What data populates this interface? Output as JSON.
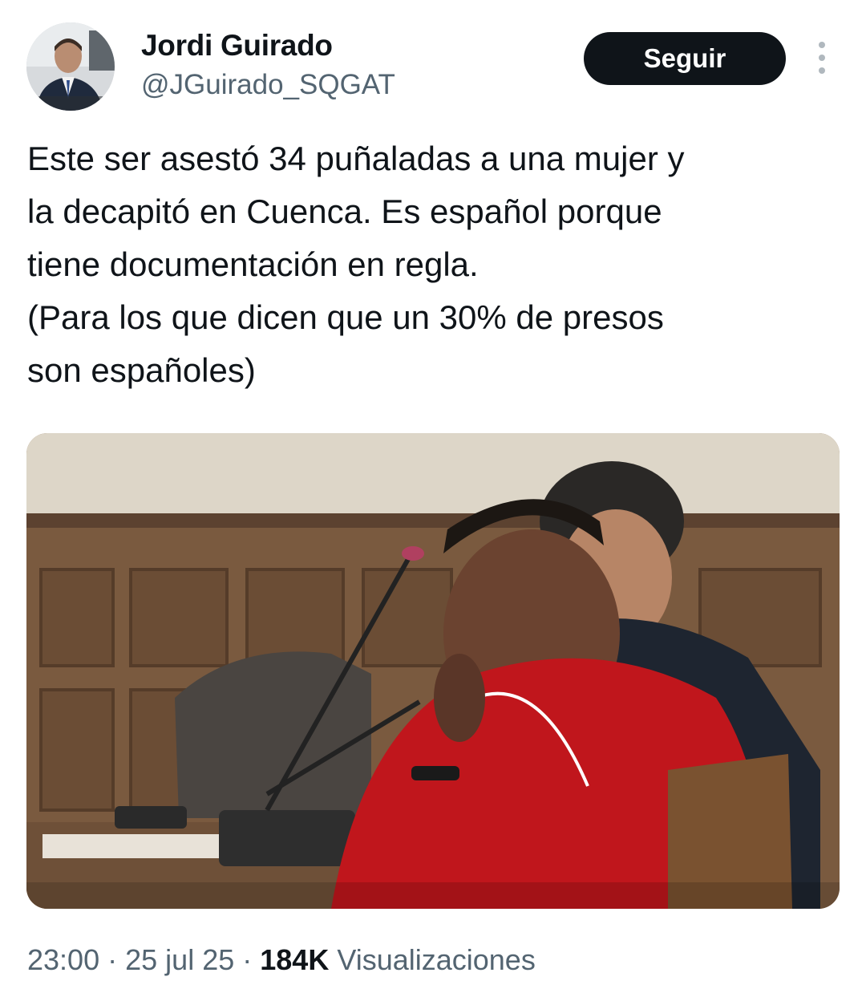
{
  "author": {
    "display_name": "Jordi Guirado",
    "handle": "@JGuirado_SQGAT",
    "avatar_icon": "profile-photo"
  },
  "follow_button": {
    "label": "Seguir"
  },
  "more_menu": {
    "icon": "vertical-ellipsis-icon"
  },
  "tweet": {
    "text_lines": [
      "Este ser asestó 34 puñaladas a una mujer y",
      "la decapitó en Cuenca. Es español porque",
      "tiene documentación en regla.",
      "(Para los que dicen que un 30% de presos",
      "son españoles)"
    ],
    "media": {
      "kind": "photo"
    }
  },
  "meta": {
    "time": "23:00",
    "separator": "·",
    "date": "25 jul 25",
    "views_count": "184K",
    "views_label": "Visualizaciones"
  },
  "colors": {
    "text_primary": "#0f1419",
    "text_secondary": "#536471",
    "button_bg": "#0f1419",
    "button_text": "#ffffff",
    "background": "#ffffff"
  }
}
